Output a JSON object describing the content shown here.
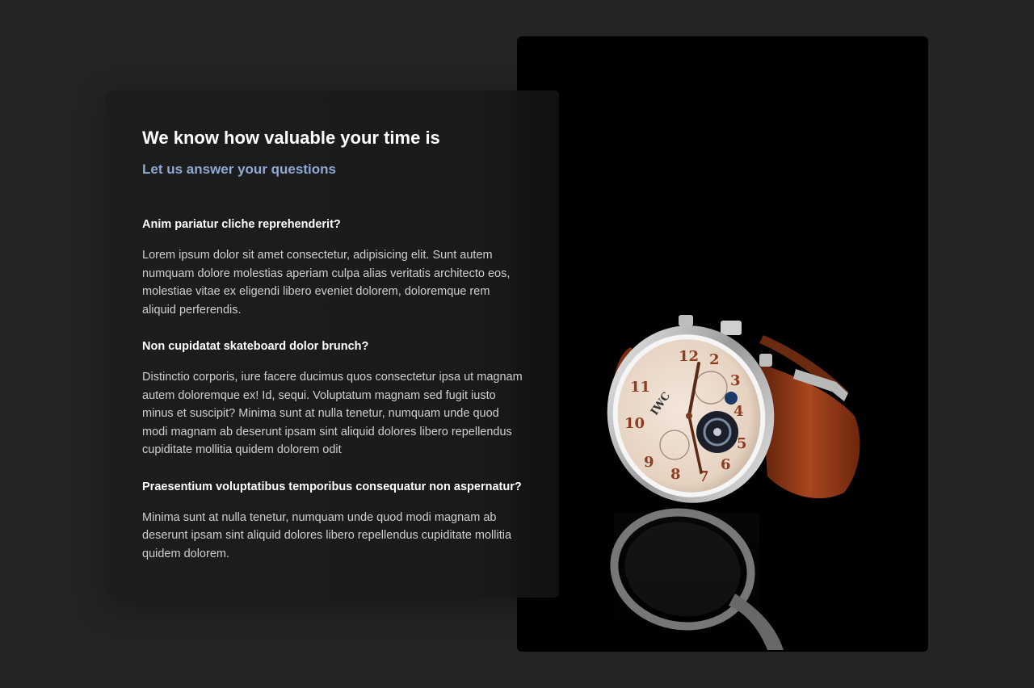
{
  "faq": {
    "title": "We know how valuable your time is",
    "subtitle": "Let us answer your questions",
    "items": [
      {
        "question": "Anim pariatur cliche reprehenderit?",
        "answer": "Lorem ipsum dolor sit amet consectetur, adipisicing elit. Sunt autem numquam dolore molestias aperiam culpa alias veritatis architecto eos, molestiae vitae ex eligendi libero eveniet dolorem, doloremque rem aliquid perferendis."
      },
      {
        "question": "Non cupidatat skateboard dolor brunch?",
        "answer": "Distinctio corporis, iure facere ducimus quos consectetur ipsa ut magnam autem doloremque ex! Id, sequi. Voluptatum magnam sed fugit iusto minus et suscipit? Minima sunt at nulla tenetur, numquam unde quod modi magnam ab deserunt ipsam sint aliquid dolores libero repellendus cupiditate mollitia quidem dolorem odit"
      },
      {
        "question": "Praesentium voluptatibus temporibus consequatur non aspernatur?",
        "answer": "Minima sunt at nulla tenetur, numquam unde quod modi magnam ab deserunt ipsam sint aliquid dolores libero repellendus cupiditate mollitia quidem dolorem."
      }
    ]
  },
  "photo": {
    "subject": "wristwatch-photo",
    "dial_brand": "IWC"
  },
  "colors": {
    "page_background": "#242424",
    "card_background": "#1c1c1c",
    "title": "#ffffff",
    "subtitle_accent": "#8fa9d6",
    "body_text": "#cfcfcf",
    "strap": "#8a3516"
  }
}
